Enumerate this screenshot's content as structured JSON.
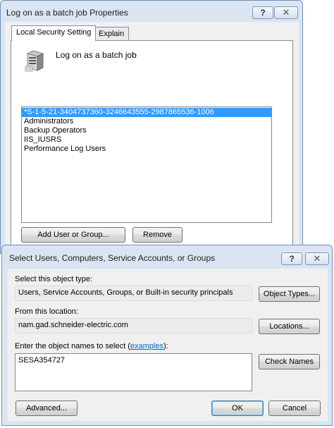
{
  "back_dialog": {
    "title": "Log on as a batch job Properties",
    "tabs": [
      {
        "label": "Local Security Setting"
      },
      {
        "label": "Explain"
      }
    ],
    "policy_name": "Log on as a batch job",
    "members": [
      "*S-1-5-21-3404737360-3246643555-2987865536-1006",
      "Administrators",
      "Backup Operators",
      "IIS_IUSRS",
      "Performance Log Users"
    ],
    "add_button": "Add User or Group...",
    "remove_button": "Remove",
    "help_glyph": "?",
    "close_glyph": "✕"
  },
  "front_dialog": {
    "title": "Select Users, Computers, Service Accounts, or Groups",
    "object_type_label": "Select this object type:",
    "object_type_value": "Users, Service Accounts, Groups, or Built-in security principals",
    "object_types_button": "Object Types...",
    "location_label": "From this location:",
    "location_value": "nam.gad.schneider-electric.com",
    "locations_button": "Locations...",
    "names_label_prefix": "Enter the object names to select (",
    "names_label_link": "examples",
    "names_label_suffix": "):",
    "names_value": "SESA354727",
    "check_names_button": "Check Names",
    "advanced_button": "Advanced...",
    "ok_button": "OK",
    "cancel_button": "Cancel",
    "help_glyph": "?",
    "close_glyph": "✕"
  }
}
